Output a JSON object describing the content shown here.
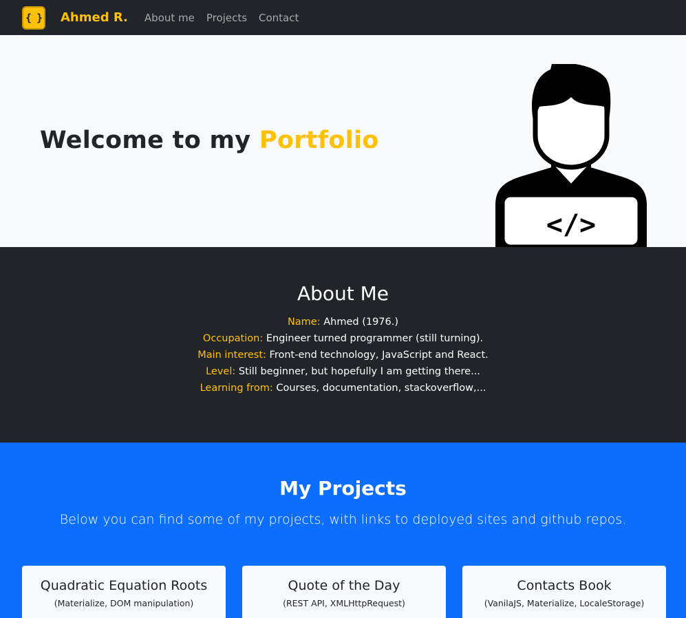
{
  "navbar": {
    "logo_glyph": "{ }",
    "brand": "Ahmed R.",
    "links": [
      "About me",
      "Projects",
      "Contact"
    ]
  },
  "hero": {
    "title_prefix": "Welcome to my ",
    "title_accent": "Portfolio",
    "figure_code": "</>"
  },
  "about": {
    "title": "About Me",
    "rows": [
      {
        "key": "Name:",
        "value": " Ahmed (1976.)"
      },
      {
        "key": "Occupation:",
        "value": " Engineer turned programmer (still turning)."
      },
      {
        "key": "Main interest:",
        "value": " Front-end technology, JavaScript and React."
      },
      {
        "key": "Level:",
        "value": " Still beginner, but hopefully I am getting there..."
      },
      {
        "key": "Learning from:",
        "value": " Courses, documentation, stackoverflow,..."
      }
    ]
  },
  "projects": {
    "title": "My Projects",
    "lead": "Below you can find some of my projects, with links to deployed sites and github repos.",
    "cards": [
      {
        "title": "Quadratic Equation Roots",
        "tech": "(Materialize, DOM manipulation)"
      },
      {
        "title": "Quote of the Day",
        "tech": "(REST API, XMLHttpRequest)"
      },
      {
        "title": "Contacts Book",
        "tech": "(VanilaJS, Materialize, LocaleStorage)"
      }
    ]
  },
  "colors": {
    "dark": "#212529",
    "accent": "#ffc107",
    "primary": "#0d6efd",
    "light": "#f8f9fa"
  }
}
